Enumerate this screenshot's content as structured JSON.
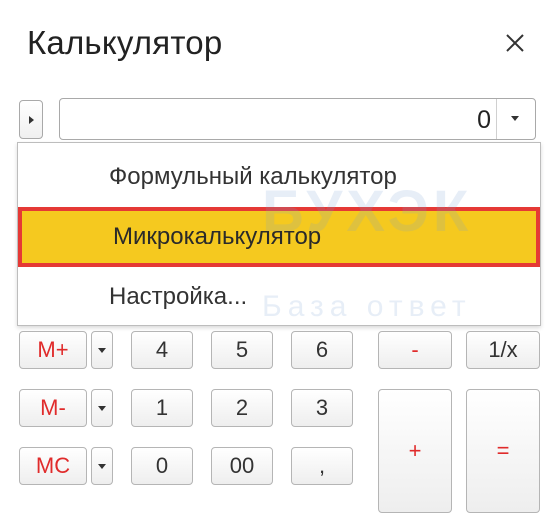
{
  "window": {
    "title": "Калькулятор"
  },
  "display": {
    "value": "0"
  },
  "menu": {
    "items": [
      {
        "label": "Формульный калькулятор"
      },
      {
        "label": "Микрокалькулятор",
        "highlighted": true
      },
      {
        "label": "Настройка..."
      }
    ],
    "highlight_fill": "#f5c91f",
    "highlight_border": "#e53935"
  },
  "watermark": {
    "text": "БУХЭК",
    "sub": "База ответ"
  },
  "keypad": {
    "memory": [
      "M+",
      "M-",
      "MC"
    ],
    "digits_row1": [
      "4",
      "5",
      "6"
    ],
    "digits_row2": [
      "1",
      "2",
      "3"
    ],
    "digits_row3": [
      "0",
      "00",
      ","
    ],
    "minus": "-",
    "reciprocal": "1/x",
    "plus": "+",
    "equals": "="
  },
  "colors": {
    "accent_red": "#e02b2b"
  }
}
